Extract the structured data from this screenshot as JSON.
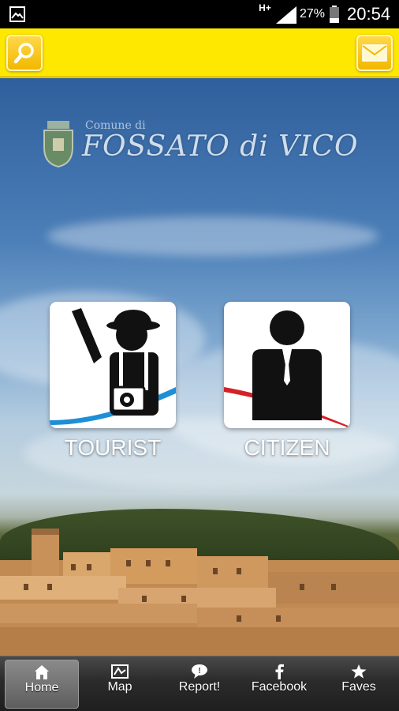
{
  "status_bar": {
    "network": "H+",
    "battery_percent": "27%",
    "time": "20:54"
  },
  "header": {
    "search_icon": "search-icon",
    "mail_icon": "mail-icon",
    "accent_color": "#ffe800"
  },
  "logo": {
    "comune_label": "Comune di",
    "title": "FOSSATO di VICO"
  },
  "tiles": [
    {
      "label": "TOURIST",
      "icon": "tourist-icon",
      "wave_color": "#1e8fd6"
    },
    {
      "label": "CITIZEN",
      "icon": "citizen-icon",
      "wave_color": "#d42026"
    }
  ],
  "tabbar": {
    "items": [
      {
        "label": "Home",
        "icon": "home-icon",
        "active": true
      },
      {
        "label": "Map",
        "icon": "map-icon",
        "active": false
      },
      {
        "label": "Report!",
        "icon": "report-icon",
        "active": false
      },
      {
        "label": "Facebook",
        "icon": "facebook-icon",
        "active": false
      },
      {
        "label": "Faves",
        "icon": "star-icon",
        "active": false
      }
    ]
  }
}
